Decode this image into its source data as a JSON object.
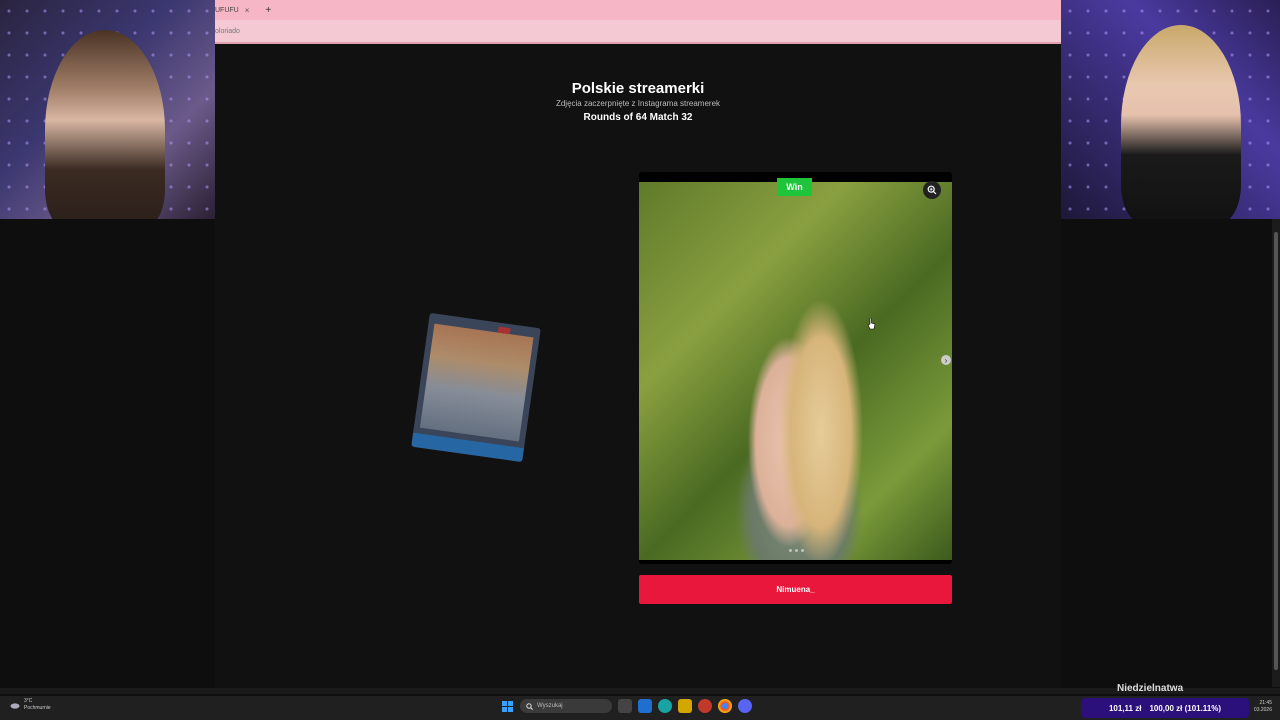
{
  "browser": {
    "tab_title": "UFUFU",
    "tab_close": "×",
    "new_tab": "+",
    "address": "oloriado"
  },
  "page": {
    "title": "Polskie streamerki",
    "subtitle": "Zdjęcia zaczerpnięte z Instagrama streamerek",
    "round_info": "Rounds of 64 Match 32"
  },
  "winner": {
    "badge": "Win",
    "name": "Nimuena_"
  },
  "taskbar": {
    "weather_temp": "3°C",
    "weather_desc": "Pochmurnie",
    "search_placeholder": "Wyszukaj",
    "time": "21:45",
    "date": "03.2026"
  },
  "stream": {
    "donation_left": "101,11 zł",
    "donation_right": "100,00 zł (101.11%)",
    "overlay_text": "Niedzielnatwa"
  },
  "colors": {
    "tabbar": "#f7b6c6",
    "win_green": "#1ec53a",
    "name_red": "#e8173b",
    "donation_purple": "#2b0f7a"
  }
}
